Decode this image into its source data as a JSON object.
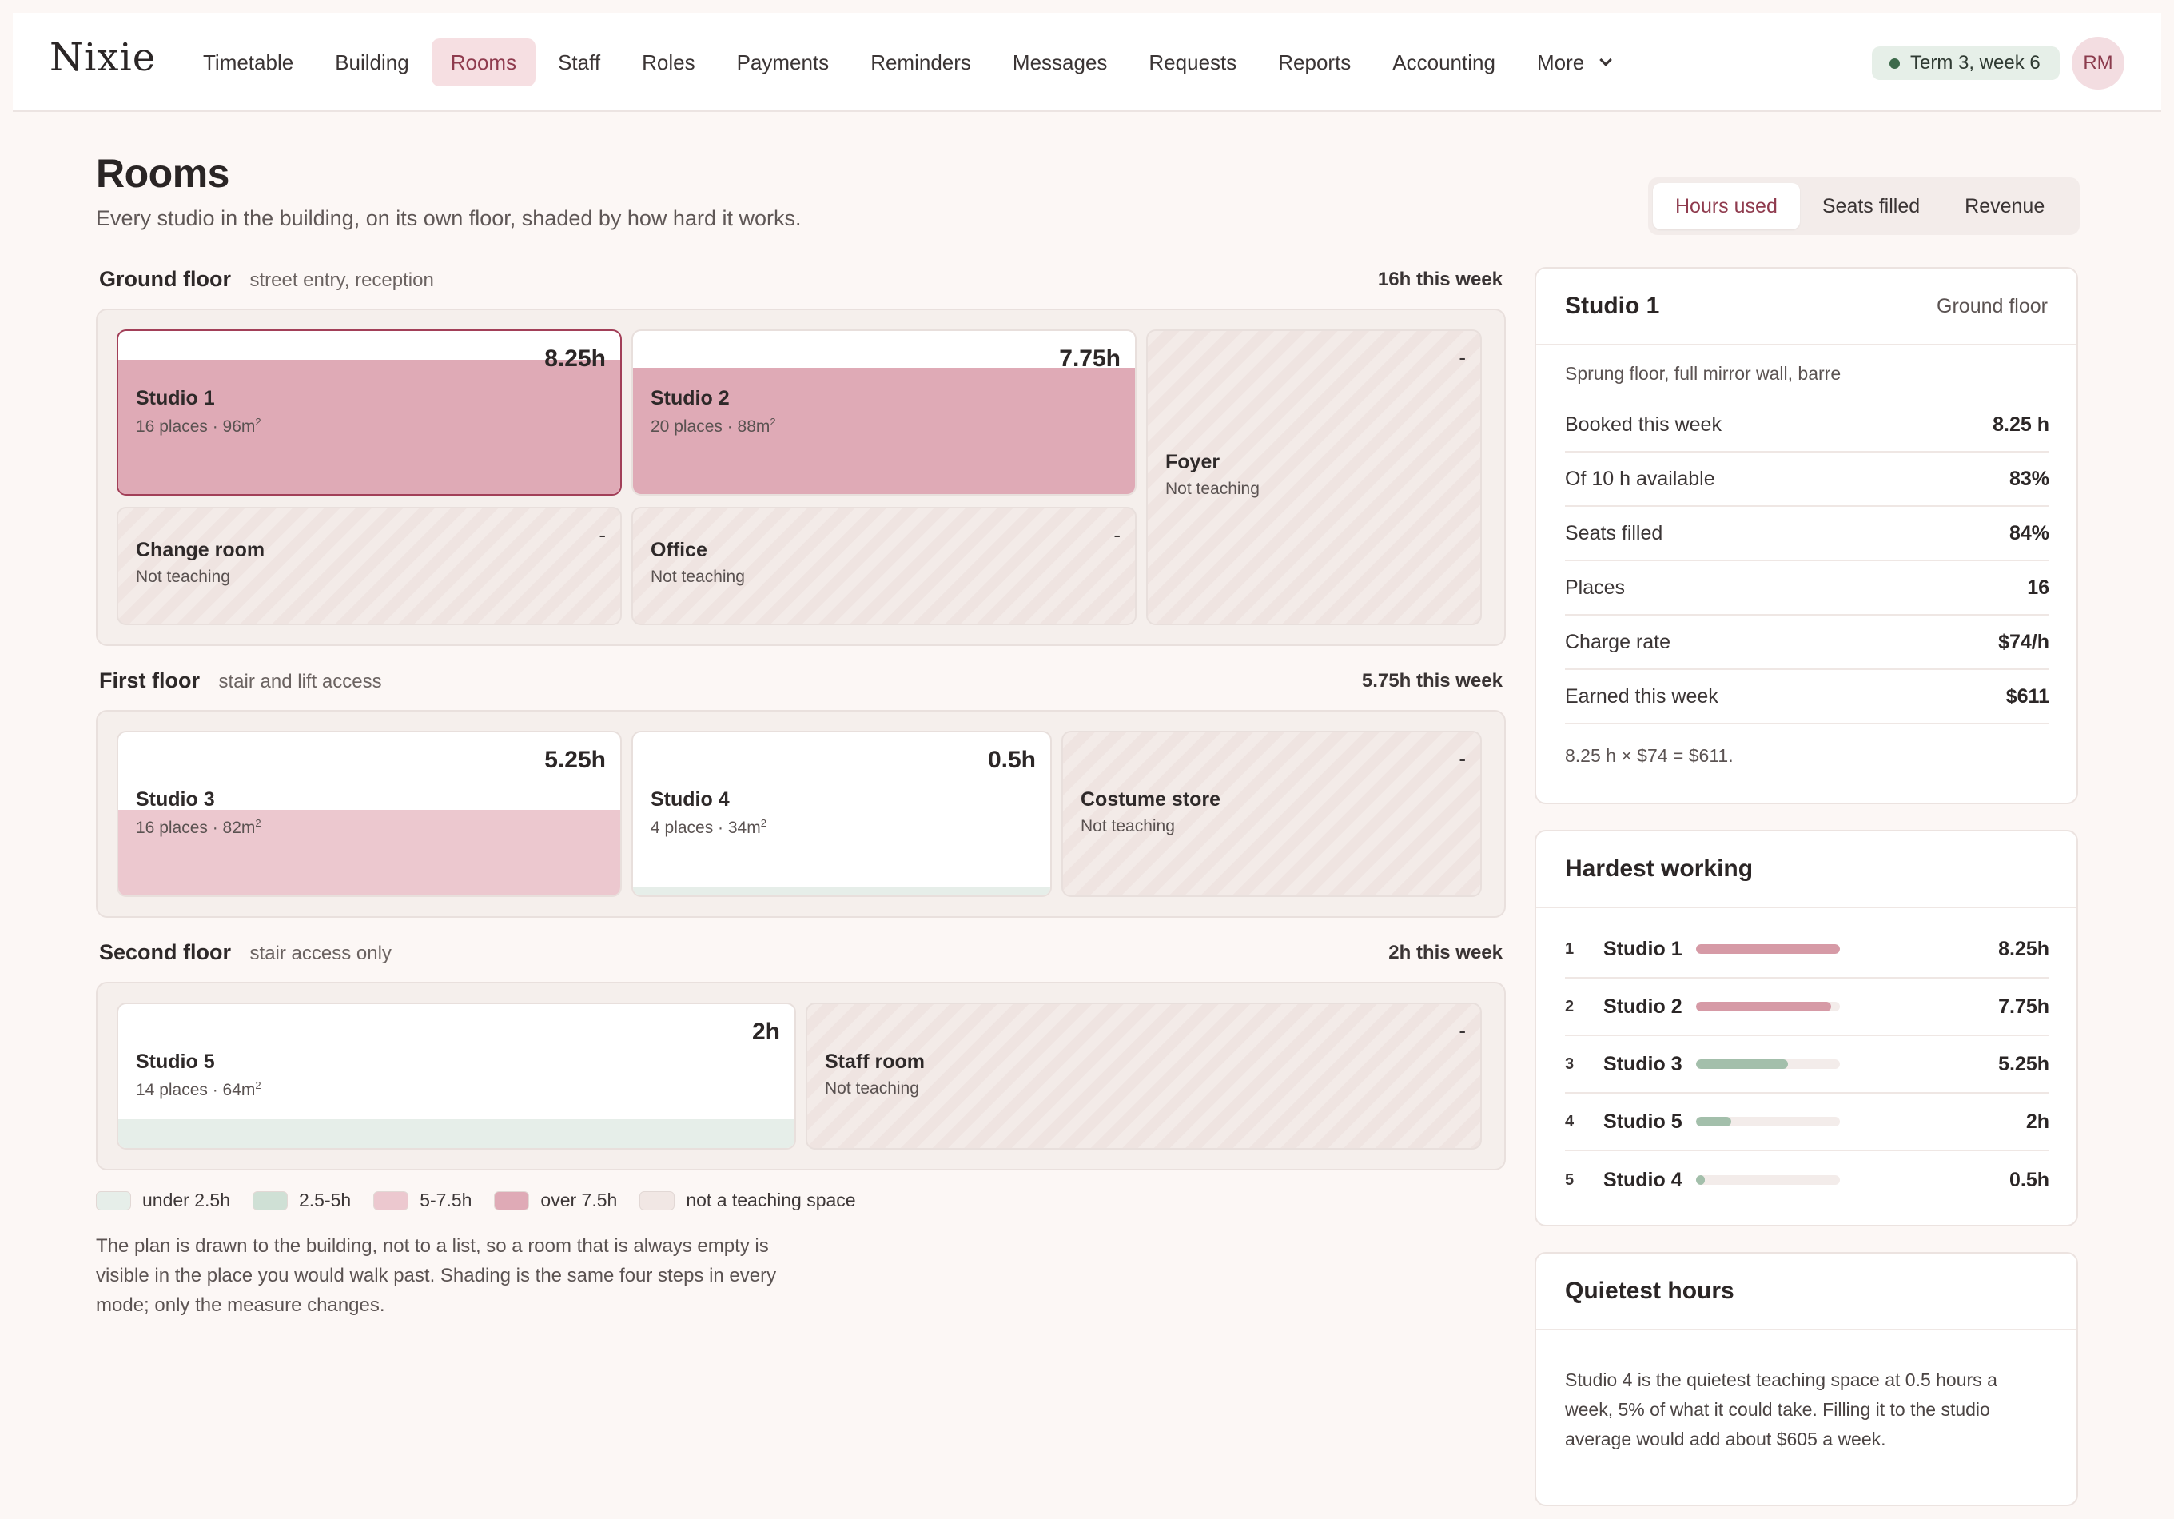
{
  "app": {
    "logo": "Nixie",
    "nav": [
      {
        "label": "Timetable",
        "active": false
      },
      {
        "label": "Building",
        "active": false
      },
      {
        "label": "Rooms",
        "active": true
      },
      {
        "label": "Staff",
        "active": false
      },
      {
        "label": "Roles",
        "active": false
      },
      {
        "label": "Payments",
        "active": false
      },
      {
        "label": "Reminders",
        "active": false
      },
      {
        "label": "Messages",
        "active": false
      },
      {
        "label": "Requests",
        "active": false
      },
      {
        "label": "Reports",
        "active": false
      },
      {
        "label": "Accounting",
        "active": false
      }
    ],
    "more_label": "More",
    "term": "Term 3, week 6",
    "avatar": "RM"
  },
  "page": {
    "title": "Rooms",
    "subtitle": "Every studio in the building, on its own floor, shaded by how hard it works.",
    "modes": [
      "Hours used",
      "Seats filled",
      "Revenue"
    ],
    "active_mode": "Hours used"
  },
  "floors": [
    {
      "name": "Ground floor",
      "desc": "street entry, reception",
      "total": "16h this week",
      "rooms": [
        {
          "name": "Studio 1",
          "meta": "16 places · 96m",
          "sup": "2",
          "value": "8.25h",
          "hours": 8.25,
          "teaching": true,
          "selected": true
        },
        {
          "name": "Studio 2",
          "meta": "20 places · 88m",
          "sup": "2",
          "value": "7.75h",
          "hours": 7.75,
          "teaching": true,
          "selected": false
        },
        {
          "name": "Foyer",
          "meta": "Not teaching",
          "value": "-",
          "teaching": false
        },
        {
          "name": "Change room",
          "meta": "Not teaching",
          "value": "-",
          "teaching": false
        },
        {
          "name": "Office",
          "meta": "Not teaching",
          "value": "-",
          "teaching": false
        }
      ]
    },
    {
      "name": "First floor",
      "desc": "stair and lift access",
      "total": "5.75h this week",
      "rooms": [
        {
          "name": "Studio 3",
          "meta": "16 places · 82m",
          "sup": "2",
          "value": "5.25h",
          "hours": 5.25,
          "teaching": true
        },
        {
          "name": "Studio 4",
          "meta": "4 places · 34m",
          "sup": "2",
          "value": "0.5h",
          "hours": 0.5,
          "teaching": true
        },
        {
          "name": "Costume store",
          "meta": "Not teaching",
          "value": "-",
          "teaching": false
        }
      ]
    },
    {
      "name": "Second floor",
      "desc": "stair access only",
      "total": "2h this week",
      "rooms": [
        {
          "name": "Studio 5",
          "meta": "14 places · 64m",
          "sup": "2",
          "value": "2h",
          "hours": 2,
          "teaching": true
        },
        {
          "name": "Staff room",
          "meta": "Not teaching",
          "value": "-",
          "teaching": false
        }
      ]
    }
  ],
  "legend": [
    {
      "label": "under 2.5h",
      "color": "#e6eee9"
    },
    {
      "label": "2.5-5h",
      "color": "#cfe0d5"
    },
    {
      "label": "5-7.5h",
      "color": "#ecc8cf"
    },
    {
      "label": "over 7.5h",
      "color": "#dfaab6"
    },
    {
      "label": "not a teaching space",
      "color": "#f1e7e4"
    }
  ],
  "legend_note": "The plan is drawn to the building, not to a list, so a room that is always empty is visible in the place you would walk past. Shading is the same four steps in every mode; only the measure changes.",
  "detail": {
    "title": "Studio 1",
    "floor": "Ground floor",
    "desc": "Sprung floor, full mirror wall, barre",
    "stats": [
      {
        "label": "Booked this week",
        "value": "8.25 h"
      },
      {
        "label": "Of 10 h available",
        "value": "83%"
      },
      {
        "label": "Seats filled",
        "value": "84%"
      },
      {
        "label": "Places",
        "value": "16"
      },
      {
        "label": "Charge rate",
        "value": "$74/h"
      },
      {
        "label": "Earned this week",
        "value": "$611"
      }
    ],
    "formula": "8.25 h × $74 = $611."
  },
  "hardest": {
    "title": "Hardest working",
    "rows": [
      {
        "rank": "1",
        "name": "Studio 1",
        "value": "8.25h",
        "hours": 8.25,
        "color": "#d69aa6"
      },
      {
        "rank": "2",
        "name": "Studio 2",
        "value": "7.75h",
        "hours": 7.75,
        "color": "#d69aa6"
      },
      {
        "rank": "3",
        "name": "Studio 3",
        "value": "5.25h",
        "hours": 5.25,
        "color": "#a3bfab"
      },
      {
        "rank": "4",
        "name": "Studio 5",
        "value": "2h",
        "hours": 2,
        "color": "#a3bfab"
      },
      {
        "rank": "5",
        "name": "Studio 4",
        "value": "0.5h",
        "hours": 0.5,
        "color": "#a3bfab"
      }
    ]
  },
  "quiet": {
    "title": "Quietest hours",
    "text": "Studio 4 is the quietest teaching space at 0.5 hours a week, 5% of what it could take. Filling it to the studio average would add about $605 a week."
  },
  "colors": {
    "accent": "#8f3b4e",
    "over_7_5": "#dfaab6",
    "band_5_7_5": "#ecc8cf",
    "band_2_5_5": "#cfe0d5",
    "under_2_5": "#e6eee9"
  }
}
